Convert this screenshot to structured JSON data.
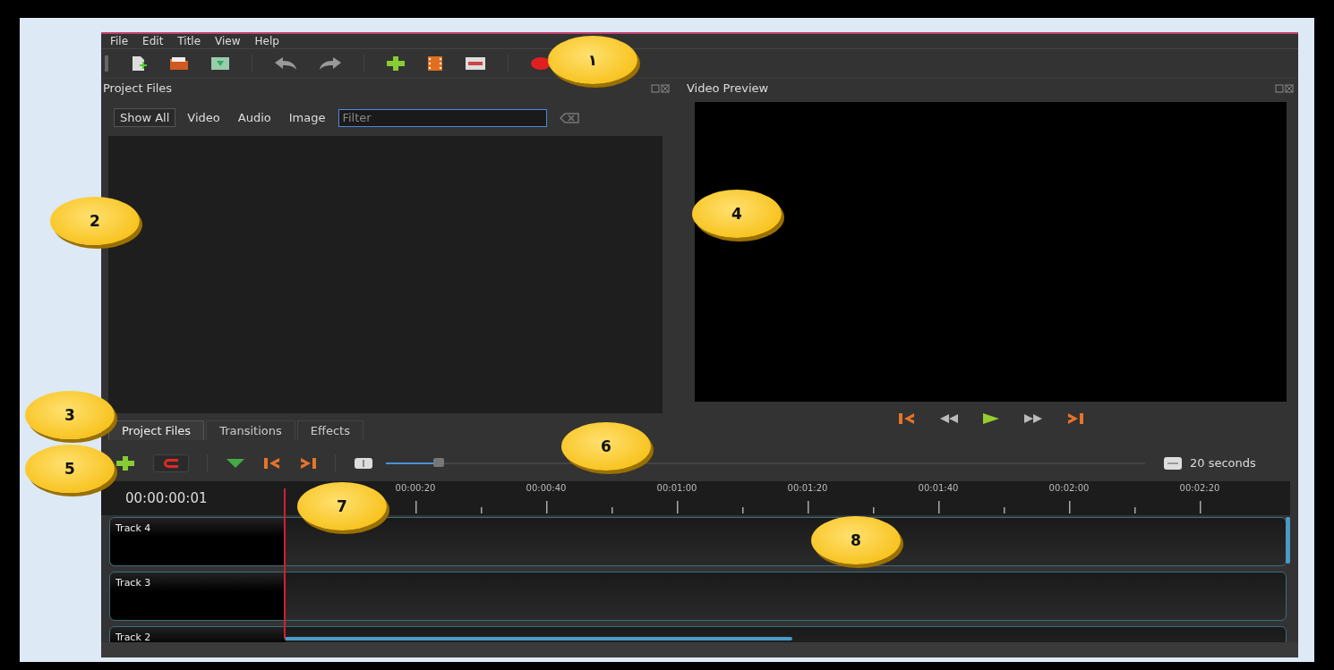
{
  "menu": [
    {
      "label": "File"
    },
    {
      "label": "Edit"
    },
    {
      "label": "Title"
    },
    {
      "label": "View"
    },
    {
      "label": "Help"
    }
  ],
  "project_files": {
    "title": "Project Files",
    "filters": [
      {
        "label": "Show All",
        "selected": true
      },
      {
        "label": "Video",
        "selected": false
      },
      {
        "label": "Audio",
        "selected": false
      },
      {
        "label": "Image",
        "selected": false
      }
    ],
    "search": {
      "placeholder": "Filter"
    }
  },
  "video_preview": {
    "title": "Video Preview"
  },
  "bottom_tabs": [
    {
      "label": "Project Files",
      "selected": true
    },
    {
      "label": "Transitions",
      "selected": false
    },
    {
      "label": "Effects",
      "selected": false
    }
  ],
  "timeline": {
    "zoom": {
      "level": 0.07,
      "reading": "20 seconds"
    },
    "timecode": "00:00:00:01",
    "ruler_labels": [
      "00:00:20",
      "00:00:40",
      "00:01:00",
      "00:01:20",
      "00:01:40",
      "00:02:00",
      "00:02:20"
    ],
    "tracks": [
      {
        "name": "Track 4"
      },
      {
        "name": "Track 3"
      },
      {
        "name": "Track 2"
      }
    ]
  },
  "callouts": [
    "١",
    "2",
    "3",
    "4",
    "5",
    "6",
    "7",
    "8"
  ]
}
